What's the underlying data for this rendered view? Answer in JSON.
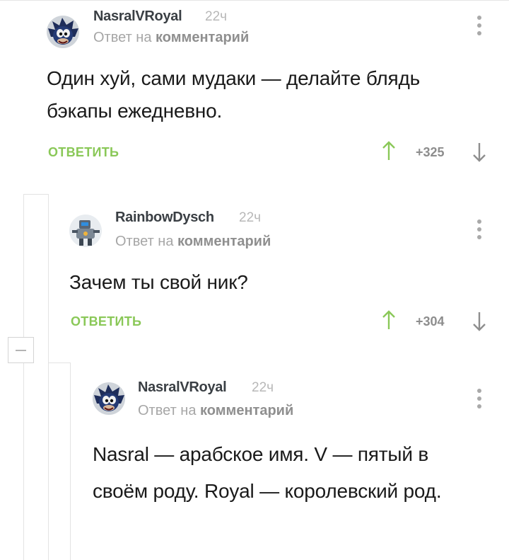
{
  "comments": [
    {
      "username": "NasralVRoyal",
      "time": "22ч",
      "reply_to_prefix": "Ответ на",
      "reply_to_link": "комментарий",
      "text": "Один хуй, сами мудаки — делайте блядь бэкапы ежедневно.",
      "reply_label": "ОТВЕТИТЬ",
      "rating": "+325",
      "avatar_icon": "sonic-avatar"
    },
    {
      "username": "RainbowDysch",
      "time": "22ч",
      "reply_to_prefix": "Ответ на",
      "reply_to_link": "комментарий",
      "text": "Зачем ты свой ник?",
      "reply_label": "ОТВЕТИТЬ",
      "rating": "+304",
      "avatar_icon": "robot-avatar"
    },
    {
      "username": "NasralVRoyal",
      "time": "22ч",
      "reply_to_prefix": "Ответ на",
      "reply_to_link": "комментарий",
      "text": "Nasral — арабское имя. V — пятый в своём роду. Royal — королевский род.",
      "avatar_icon": "sonic-avatar"
    }
  ],
  "colors": {
    "accent_green": "#8ac858",
    "username": "#3a3f44",
    "meta": "#a6a6a6"
  }
}
